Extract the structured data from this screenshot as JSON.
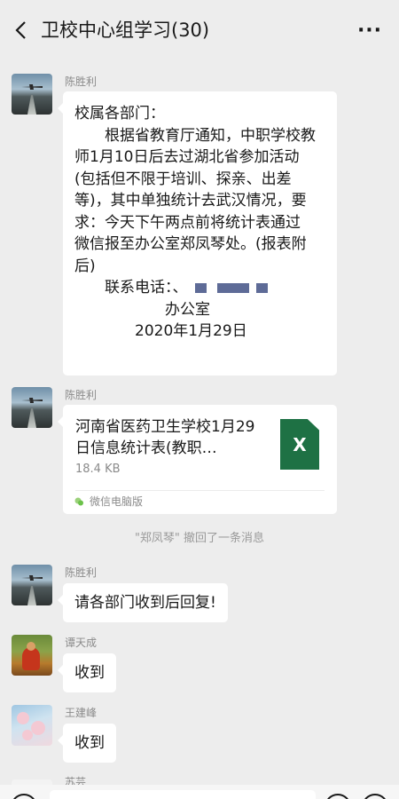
{
  "header": {
    "title": "卫校中心组学习(30)",
    "back_icon": "chevron-left-icon",
    "more_icon": "more-icon",
    "more_glyph": "···"
  },
  "messages": [
    {
      "sender": "陈胜利",
      "lines": [
        "校属各部门：",
        "　　根据省教育厅通知，中职学校教",
        "师1月10日后去过湖北省参加活动",
        "(包括但不限于培训、探亲、出差",
        "等)，其中单独统计去武汉情况，要",
        "求：今天下午两点前将统计表通过",
        "微信报至办公室郑凤琴处。(报表附",
        "后)",
        "　　联系电话：、",
        "　　　　　　办公室",
        "　　　　2020年1月29日"
      ]
    },
    {
      "sender": "陈胜利",
      "file_title": "河南省医药卫生学校1月29日信息统计表(教职…",
      "file_size": "18.4 KB",
      "file_icon_letter": "X",
      "source": "微信电脑版"
    },
    {
      "system": "\"郑凤琴\" 撤回了一条消息"
    },
    {
      "sender": "陈胜利",
      "text": "请各部门收到后回复!"
    },
    {
      "sender": "谭天成",
      "text": "收到"
    },
    {
      "sender": "王建峰",
      "text": "收到"
    },
    {
      "sender": "苏芸"
    }
  ],
  "colors": {
    "background": "#ededed",
    "bubble": "#ffffff",
    "excel_green": "#1e7144",
    "redaction": "#5e6b97"
  }
}
